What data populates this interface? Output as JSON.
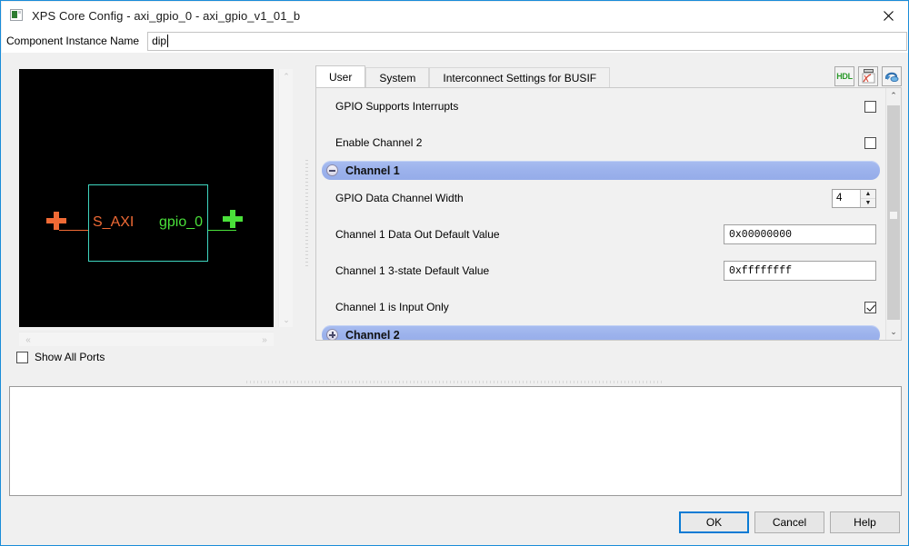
{
  "window": {
    "title": "XPS Core Config - axi_gpio_0 - axi_gpio_v1_01_b",
    "icon": "core-config-icon",
    "close_label": "✕"
  },
  "instance": {
    "label": "Component Instance Name",
    "value": "dip",
    "placeholder": ""
  },
  "preview": {
    "block": {
      "left_port": "S_AXI",
      "right_port": "gpio_0",
      "left_port_color": "#ef6a35",
      "right_port_color": "#4ae03a",
      "border_color": "#3fd6c0",
      "background": "#000000"
    },
    "scroll_up": "⌃",
    "scroll_down": "⌄",
    "scroll_left": "«",
    "scroll_right": "»",
    "show_all_ports": {
      "label": "Show All Ports",
      "checked": false
    }
  },
  "tabs": [
    {
      "label": "User",
      "active": true
    },
    {
      "label": "System",
      "active": false
    },
    {
      "label": "Interconnect Settings for BUSIF",
      "active": false
    }
  ],
  "toolbar": [
    {
      "name": "hdl-icon",
      "label": "HDL"
    },
    {
      "name": "datasheet-pdf-icon",
      "label": ""
    },
    {
      "name": "restore-defaults-icon",
      "label": ""
    }
  ],
  "settings": [
    {
      "type": "checkbox",
      "name": "gpio-supports-interrupts",
      "label": "GPIO Supports Interrupts",
      "checked": false
    },
    {
      "type": "checkbox",
      "name": "enable-channel-2",
      "label": "Enable Channel 2",
      "checked": false
    },
    {
      "type": "group",
      "name": "channel-1-group",
      "label": "Channel 1",
      "expanded": true,
      "toggle_glyph": "−"
    },
    {
      "type": "spinner",
      "name": "gpio-data-channel-width",
      "label": "GPIO Data Channel Width",
      "value": "4",
      "up_glyph": "▲",
      "down_glyph": "▼"
    },
    {
      "type": "text",
      "name": "channel-1-data-out-default-value",
      "label": "Channel 1 Data Out Default Value",
      "value": "0x00000000"
    },
    {
      "type": "text",
      "name": "channel-1-3-state-default-value",
      "label": "Channel 1 3-state Default Value",
      "value": "0xffffffff"
    },
    {
      "type": "checkbox",
      "name": "channel-1-is-input-only",
      "label": "Channel 1 is Input Only",
      "checked": true
    },
    {
      "type": "group",
      "name": "channel-2-group",
      "label": "Channel 2",
      "expanded": false,
      "toggle_glyph": "+"
    }
  ],
  "console": {
    "text": ""
  },
  "footer": {
    "ok": "OK",
    "cancel": "Cancel",
    "help": "Help"
  },
  "colors": {
    "accent": "#0a7bd4",
    "group_header": "#9cb2ec",
    "window_border": "#1a8cd8"
  }
}
